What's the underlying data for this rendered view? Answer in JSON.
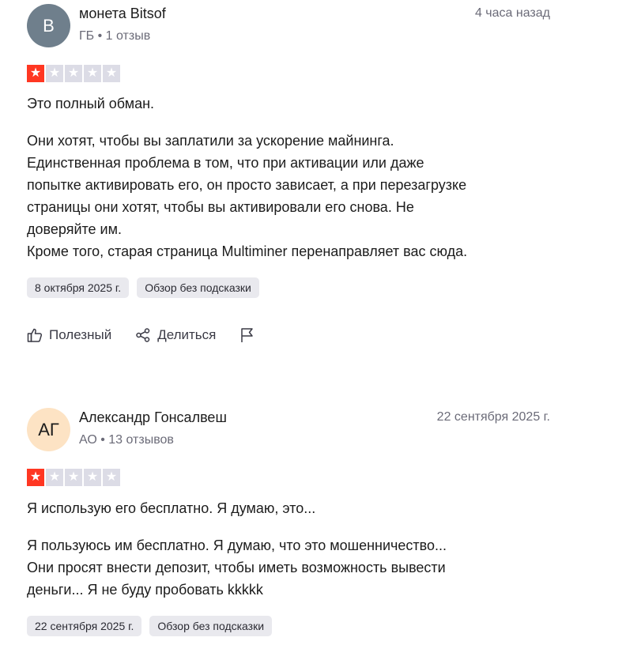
{
  "colors": {
    "star_filled": "#ff3722",
    "star_empty": "#dcdce6",
    "tag_bg": "#e9e9ee"
  },
  "reviews": [
    {
      "avatar": {
        "initials": "B",
        "bg": "#6f7f8c",
        "fg": "#ffffff"
      },
      "name": "монета Bitsof",
      "meta": "ГБ • 1 отзыв",
      "posted": "4 часа назад",
      "rating": 1,
      "title": "Это полный обман.",
      "body_lines": [
        "Они хотят, чтобы вы заплатили за ускорение майнинга.",
        "Единственная проблема в том, что при активации или даже",
        "попытке активировать его, он просто зависает, а при перезагрузке",
        "страницы они хотят, чтобы вы активировали его снова. Не",
        "доверяйте им.",
        "Кроме того, старая страница Multiminer перенаправляет вас сюда."
      ],
      "experience_date": "8 октября 2025 г.",
      "tag": "Обзор без подсказки",
      "actions": {
        "useful": "Полезный",
        "share": "Делиться"
      }
    },
    {
      "avatar": {
        "initials": "АГ",
        "bg": "#fde3c4",
        "fg": "#1c1c1c"
      },
      "name": "Александр Гонсалвеш",
      "meta": "АО • 13 отзывов",
      "posted": "22 сентября 2025 г.",
      "rating": 1,
      "title": "Я использую его бесплатно. Я думаю, это...",
      "body_lines": [
        "Я пользуюсь им бесплатно. Я думаю, что это мошенничество...",
        "Они просят внести депозит, чтобы иметь возможность вывести",
        "деньги... Я не буду пробовать kkkkk"
      ],
      "experience_date": "22 сентября 2025 г.",
      "tag": "Обзор без подсказки"
    }
  ]
}
